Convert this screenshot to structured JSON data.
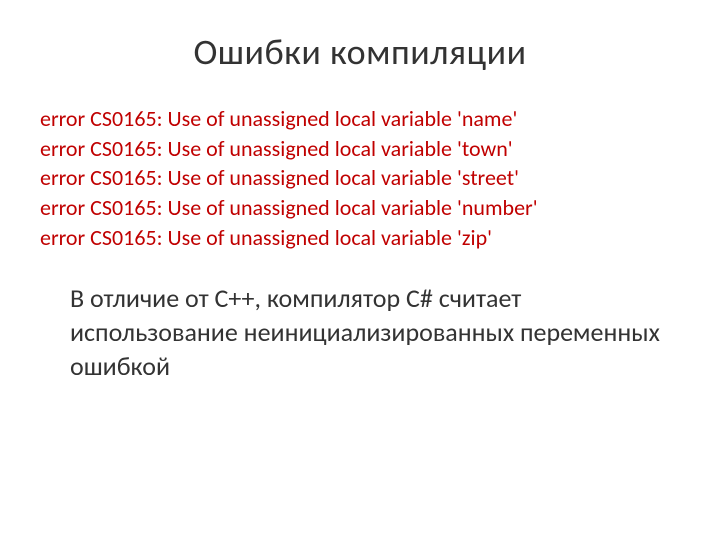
{
  "title": "Ошибки компиляции",
  "errors": [
    "error CS0165: Use of unassigned local variable 'name'",
    "error CS0165: Use of unassigned local variable 'town'",
    "error CS0165: Use of unassigned local variable 'street'",
    "error CS0165: Use of unassigned local variable 'number'",
    "error CS0165: Use of unassigned local variable 'zip'"
  ],
  "explanation": "В отличие от С++, компилятор C# считает использование неинициализированных переменных ошибкой"
}
